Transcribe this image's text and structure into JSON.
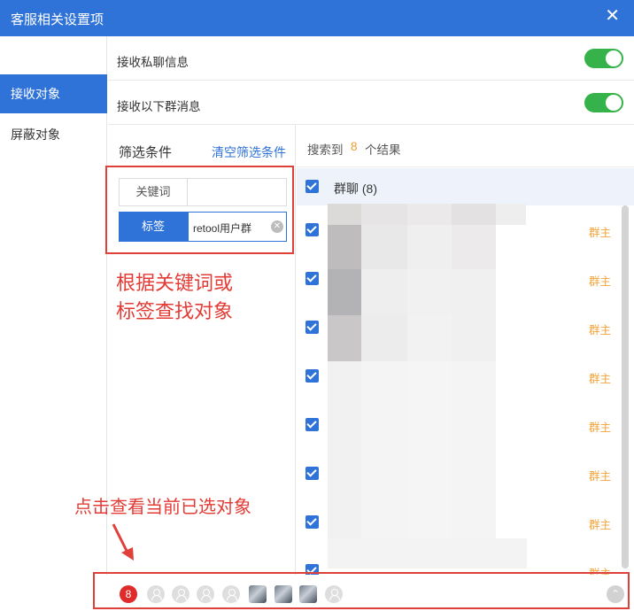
{
  "window": {
    "title": "客服相关设置项",
    "close_icon": "close-icon"
  },
  "sidebar": {
    "items": [
      {
        "label": "接收对象",
        "active": true
      },
      {
        "label": "屏蔽对象",
        "active": false
      }
    ]
  },
  "settings": {
    "private_chat": {
      "label": "接收私聊信息",
      "enabled": true
    },
    "group_chat": {
      "label": "接收以下群消息",
      "enabled": true
    }
  },
  "filter": {
    "title": "筛选条件",
    "clear_label": "清空筛选条件",
    "keyword_tab": "关键词",
    "keyword_value": "",
    "tag_tab": "标签",
    "tag_value": "retool用户群"
  },
  "annotations": {
    "filter_hint_line1": "根据关键词或",
    "filter_hint_line2": "标签查找对象",
    "bottom_hint": "点击查看当前已选对象"
  },
  "results": {
    "prefix": "搜索到",
    "count": "8",
    "suffix": "个结果",
    "group_label": "群聊",
    "group_count": "(8)",
    "items": [
      {
        "role": "群主",
        "checked": true
      },
      {
        "role": "群主",
        "checked": true
      },
      {
        "role": "群主",
        "checked": true
      },
      {
        "role": "群主",
        "checked": true
      },
      {
        "role": "群主",
        "checked": true
      },
      {
        "role": "群主",
        "checked": true
      },
      {
        "role": "群主",
        "checked": true
      },
      {
        "role": "群主",
        "checked": true
      }
    ]
  },
  "bottom_bar": {
    "selected_count": "8",
    "up_icon": "chevron-up-icon"
  },
  "colors": {
    "accent": "#2f73d8",
    "toggle_on": "#36b24a",
    "role": "#f3a337",
    "annotation": "#e33b35",
    "badge": "#e02b2b"
  }
}
